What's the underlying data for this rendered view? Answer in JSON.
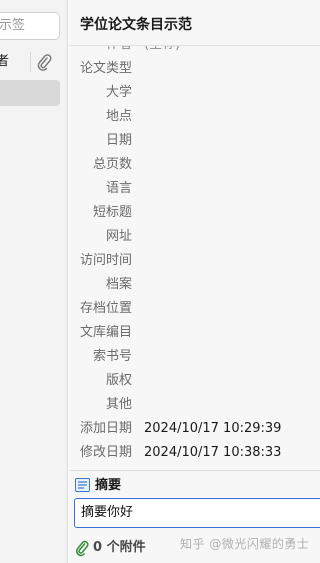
{
  "left_pane": {
    "tag_filter_placeholder": "示签",
    "row_text": "者"
  },
  "header": {
    "title": "学位论文条目示范"
  },
  "fields": [
    {
      "label": "作者",
      "value": "(全称)"
    },
    {
      "label": "论文类型",
      "value": ""
    },
    {
      "label": "大学",
      "value": ""
    },
    {
      "label": "地点",
      "value": ""
    },
    {
      "label": "日期",
      "value": ""
    },
    {
      "label": "总页数",
      "value": ""
    },
    {
      "label": "语言",
      "value": ""
    },
    {
      "label": "短标题",
      "value": ""
    },
    {
      "label": "网址",
      "value": ""
    },
    {
      "label": "访问时间",
      "value": ""
    },
    {
      "label": "档案",
      "value": ""
    },
    {
      "label": "存档位置",
      "value": ""
    },
    {
      "label": "文库编目",
      "value": ""
    },
    {
      "label": "索书号",
      "value": ""
    },
    {
      "label": "版权",
      "value": ""
    },
    {
      "label": "其他",
      "value": ""
    },
    {
      "label": "添加日期",
      "value": "2024/10/17 10:29:39"
    },
    {
      "label": "修改日期",
      "value": "2024/10/17 10:38:33"
    }
  ],
  "abstract": {
    "label": "摘要",
    "value": "摘要你好"
  },
  "attachments": {
    "label": "0 个附件"
  },
  "watermark": "知乎 @微光闪耀的勇士",
  "colors": {
    "accent_border": "#3b6fd6",
    "field_label": "#6b6b6b",
    "icon_blue": "#3a78c4",
    "clip_green": "#3f8f3f"
  }
}
